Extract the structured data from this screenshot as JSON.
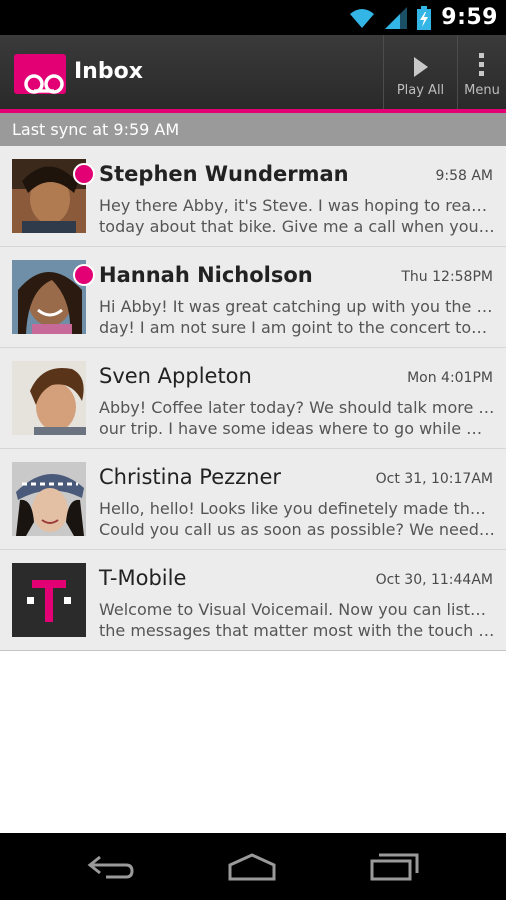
{
  "status_bar": {
    "time": "9:59",
    "icons": [
      "wifi-icon",
      "signal-icon",
      "battery-charging-icon"
    ]
  },
  "header": {
    "title": "Inbox",
    "logo_icon": "voicemail-icon",
    "play_all_label": "Play All",
    "menu_label": "Menu",
    "accent_color": "#e20074"
  },
  "sync": {
    "text": "Last sync at 9:59 AM"
  },
  "messages": [
    {
      "sender": "Stephen Wunderman",
      "time": "9:58 AM",
      "unread": true,
      "line1": "Hey there Abby, it's Steve. I was hoping to reach you",
      "line2": "today about that bike. Give me a call when you c..."
    },
    {
      "sender": "Hannah Nicholson",
      "time": "Thu 12:58PM",
      "unread": true,
      "line1": "Hi Abby! It was great catching up with you the other",
      "line2": "day! I am not sure I am goint to the concert tomor..."
    },
    {
      "sender": "Sven Appleton",
      "time": "Mon 4:01PM",
      "unread": false,
      "line1": "Abby! Coffee later today? We should talk more about",
      "line2": "our trip. I have some ideas where to go while we a..."
    },
    {
      "sender": "Christina Pezzner",
      "time": "Oct 31, 10:17AM",
      "unread": false,
      "line1": "Hello, hello! Looks like you definetely made the cut!",
      "line2": "Could you call us as soon as possible? We need to..."
    },
    {
      "sender": "T-Mobile",
      "time": "Oct 30, 11:44AM",
      "unread": false,
      "line1": "Welcome to Visual Voicemail. Now you can listen to",
      "line2": "the messages that matter most with the touch of ..."
    }
  ],
  "nav_bar": {
    "icons": [
      "back-icon",
      "home-icon",
      "recent-apps-icon"
    ]
  }
}
